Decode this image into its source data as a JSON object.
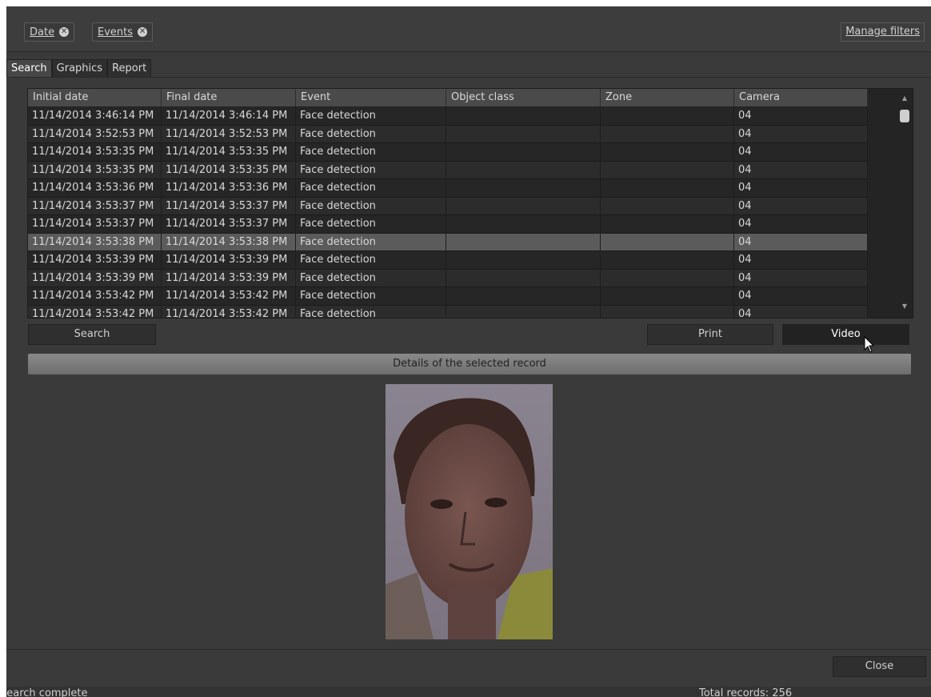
{
  "filters": [
    {
      "label": "Date"
    },
    {
      "label": "Events"
    }
  ],
  "manage_filters_label": "Manage filters",
  "tabs": [
    {
      "label": "Search"
    },
    {
      "label": "Graphics"
    },
    {
      "label": "Report"
    }
  ],
  "table": {
    "columns": [
      "Initial date",
      "Final date",
      "Event",
      "Object class",
      "Zone",
      "Camera"
    ],
    "rows": [
      [
        "11/14/2014 3:46:14 PM",
        "11/14/2014 3:46:14 PM",
        "Face detection",
        "",
        "",
        "04"
      ],
      [
        "11/14/2014 3:52:53 PM",
        "11/14/2014 3:52:53 PM",
        "Face detection",
        "",
        "",
        "04"
      ],
      [
        "11/14/2014 3:53:35 PM",
        "11/14/2014 3:53:35 PM",
        "Face detection",
        "",
        "",
        "04"
      ],
      [
        "11/14/2014 3:53:35 PM",
        "11/14/2014 3:53:35 PM",
        "Face detection",
        "",
        "",
        "04"
      ],
      [
        "11/14/2014 3:53:36 PM",
        "11/14/2014 3:53:36 PM",
        "Face detection",
        "",
        "",
        "04"
      ],
      [
        "11/14/2014 3:53:37 PM",
        "11/14/2014 3:53:37 PM",
        "Face detection",
        "",
        "",
        "04"
      ],
      [
        "11/14/2014 3:53:37 PM",
        "11/14/2014 3:53:37 PM",
        "Face detection",
        "",
        "",
        "04"
      ],
      [
        "11/14/2014 3:53:38 PM",
        "11/14/2014 3:53:38 PM",
        "Face detection",
        "",
        "",
        "04"
      ],
      [
        "11/14/2014 3:53:39 PM",
        "11/14/2014 3:53:39 PM",
        "Face detection",
        "",
        "",
        "04"
      ],
      [
        "11/14/2014 3:53:39 PM",
        "11/14/2014 3:53:39 PM",
        "Face detection",
        "",
        "",
        "04"
      ],
      [
        "11/14/2014 3:53:42 PM",
        "11/14/2014 3:53:42 PM",
        "Face detection",
        "",
        "",
        "04"
      ],
      [
        "11/14/2014 3:53:42 PM",
        "11/14/2014 3:53:42 PM",
        "Face detection",
        "",
        "",
        "04"
      ]
    ],
    "selected_row": 7
  },
  "buttons": {
    "search": "Search",
    "print": "Print",
    "video": "Video",
    "close": "Close"
  },
  "details_title": "Details of the selected record",
  "status": {
    "left": "Search complete",
    "right": "Total records: 256"
  },
  "icons": {
    "filter_remove": "close-circle-icon",
    "scroll_up": "arrow-up-icon",
    "scroll_down": "arrow-down-icon",
    "cursor": "mouse-pointer-icon"
  },
  "colors": {
    "background": "#3a3a3a",
    "selected_row": "#5b5b5b",
    "header": "#4a4a4a"
  }
}
